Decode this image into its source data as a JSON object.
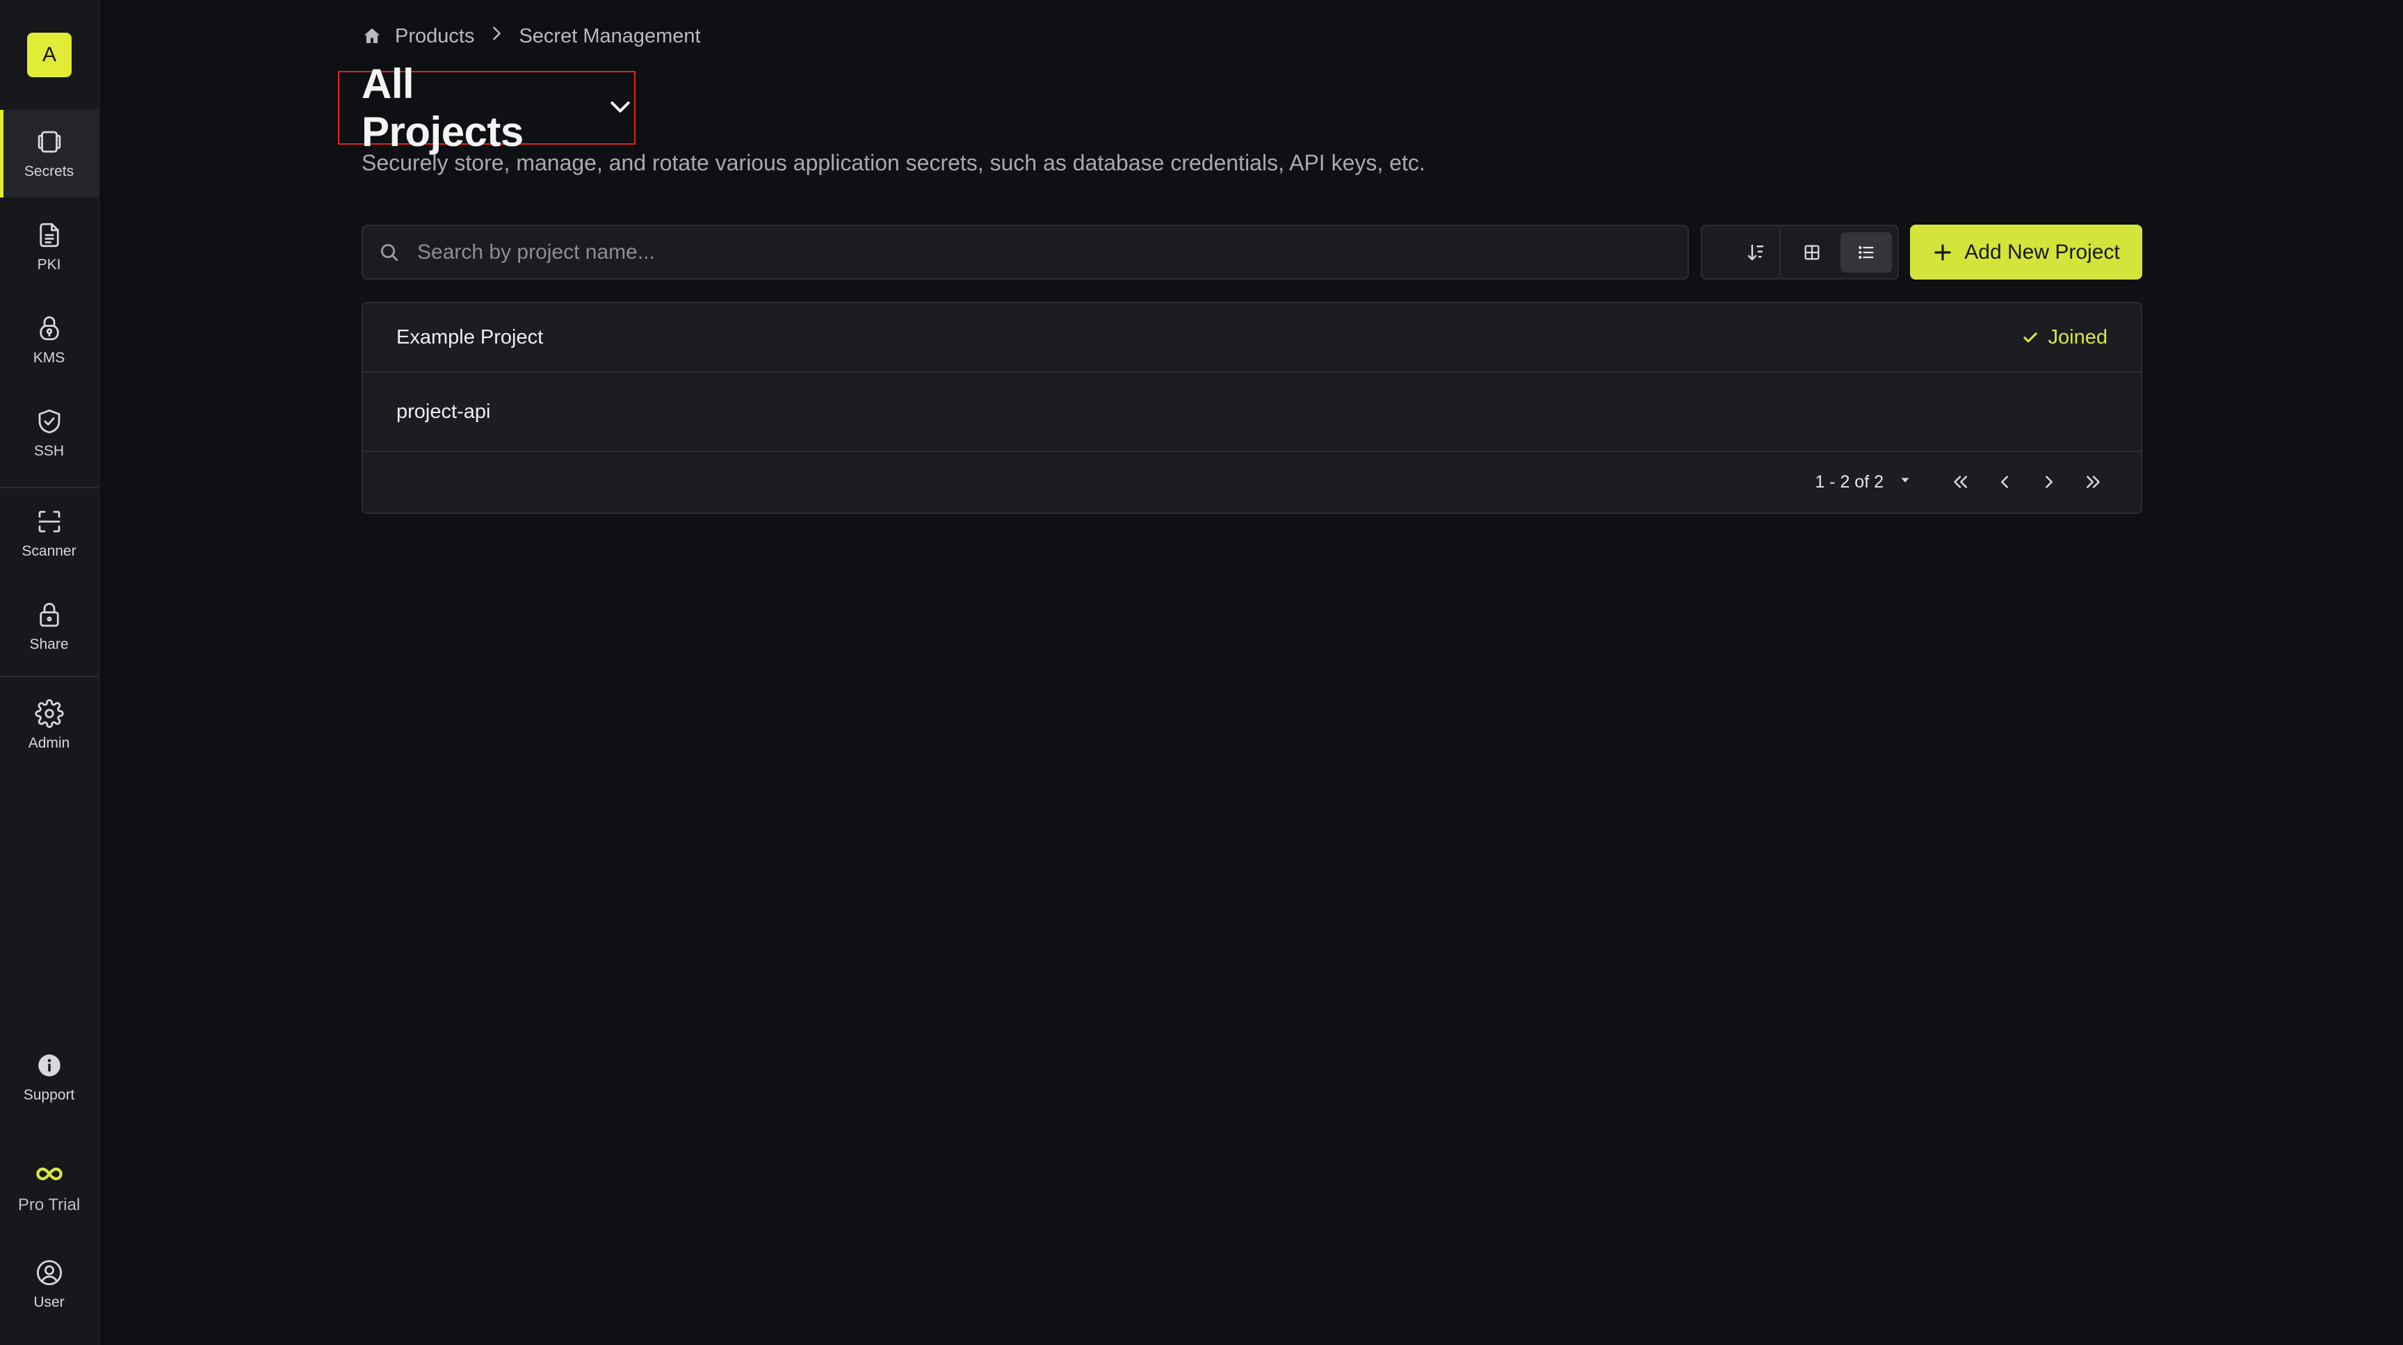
{
  "sidebar": {
    "org_initial": "A",
    "items": [
      {
        "label": "Secrets",
        "icon": "vault-icon",
        "active": true
      },
      {
        "label": "PKI",
        "icon": "certificate-file-icon"
      },
      {
        "label": "KMS",
        "icon": "key-lock-icon"
      },
      {
        "label": "SSH",
        "icon": "shield-check-icon"
      },
      {
        "label": "Scanner",
        "icon": "scan-frame-icon"
      },
      {
        "label": "Share",
        "icon": "lock-icon"
      },
      {
        "label": "Admin",
        "icon": "gear-icon"
      }
    ],
    "bottom": [
      {
        "label": "Support",
        "icon": "info-circle-icon"
      },
      {
        "label": "Pro Trial",
        "icon": "infinity-icon"
      },
      {
        "label": "User",
        "icon": "user-circle-icon"
      }
    ]
  },
  "breadcrumb": {
    "items": [
      "Products",
      "Secret Management"
    ]
  },
  "header": {
    "title": "All Projects",
    "subtitle": "Securely store, manage, and rotate various application secrets, such as database credentials, API keys, etc."
  },
  "toolbar": {
    "search_placeholder": "Search by project name...",
    "add_label": "Add New Project"
  },
  "projects": [
    {
      "name": "Example Project",
      "status": "Joined"
    },
    {
      "name": "project-api",
      "status": ""
    }
  ],
  "pagination": {
    "range": "1 - 2 of 2"
  },
  "colors": {
    "accent": "#d4e43a",
    "background": "#0e1014",
    "highlight_border": "#e0251f"
  }
}
